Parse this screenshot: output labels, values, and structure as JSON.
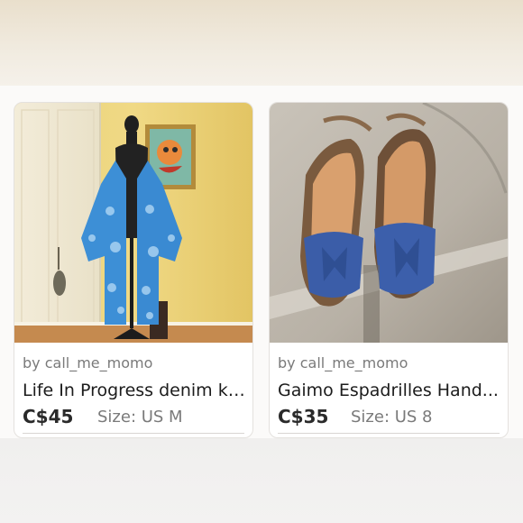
{
  "listings": [
    {
      "seller": "by call_me_momo",
      "title": "Life In Progress denim ki...",
      "price": "C$45",
      "size": "Size: US M",
      "image": "blue-kimono-on-mannequin"
    },
    {
      "seller": "by call_me_momo",
      "title": "Gaimo Espadrilles Hand...",
      "price": "C$35",
      "size": "Size: US 8",
      "image": "denim-bow-espadrille-sandals"
    }
  ],
  "colors": {
    "kimono_blue": "#3d8fd6",
    "wall_yellow": "#e8c96a",
    "denim": "#3b5da8"
  }
}
